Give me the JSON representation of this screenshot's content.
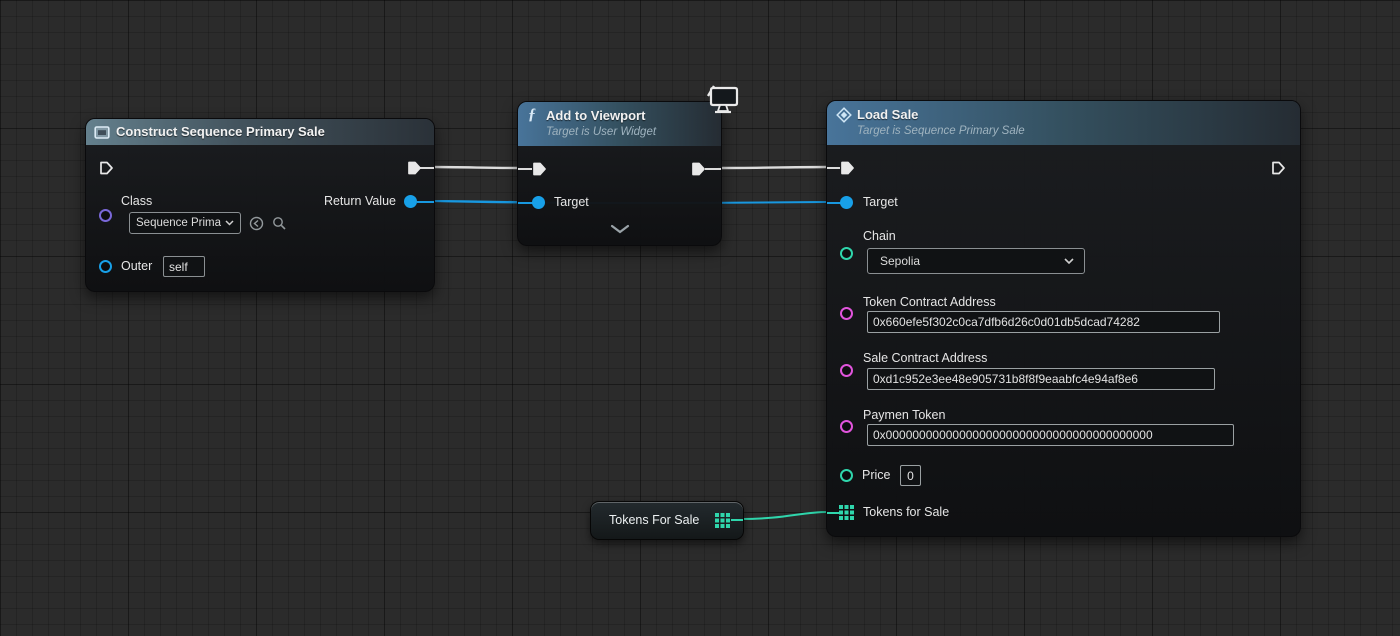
{
  "colors": {
    "canvas_bg": "#2b2b2b",
    "exec": "#e8e8e8",
    "object_pin": "#18a0e8",
    "class_pin": "#7a68d8",
    "string_pin": "#e154dc",
    "enum_pin": "#2fd6ac",
    "array_pin": "#2fd6ac",
    "wire_exec": "#dcdcdc",
    "wire_object": "#1898e0",
    "wire_array": "#2fd6ac"
  },
  "icons": {
    "function_icon": "ƒ",
    "construct_icon": "rounded-square",
    "event_diamond_icon": "diamond",
    "viewport_monitor_icon": "monitor",
    "dropdown_chevron_icon": "▾",
    "use_asset_icon": "circle-left-arrow",
    "browse_asset_icon": "magnifier",
    "collapse_chevron_icon": "⌄",
    "array_grid_icon": "3x3-grid"
  },
  "nodes": {
    "construct": {
      "title": "Construct Sequence Primary Sale",
      "class_label": "Class",
      "class_value": "Sequence Prima",
      "return_value_label": "Return Value",
      "outer_label": "Outer",
      "outer_value": "self"
    },
    "add_to_viewport": {
      "title": "Add to Viewport",
      "subtitle": "Target is User Widget",
      "target_label": "Target"
    },
    "load_sale": {
      "title": "Load Sale",
      "subtitle": "Target is Sequence Primary Sale",
      "target_label": "Target",
      "chain_label": "Chain",
      "chain_value": "Sepolia",
      "token_contract_label": "Token Contract Address",
      "token_contract_value": "0x660efe5f302c0ca7dfb6d26c0d01db5dcad74282",
      "sale_contract_label": "Sale Contract Address",
      "sale_contract_value": "0xd1c952e3ee48e905731b8f8f9eaabfc4e94af8e6",
      "payment_token_label": "Paymen Token",
      "payment_token_value": "0x0000000000000000000000000000000000000000",
      "price_label": "Price",
      "price_value": "0",
      "tokens_for_sale_label": "Tokens for Sale"
    },
    "tokens_variable": {
      "label": "Tokens For Sale"
    }
  },
  "connections": [
    {
      "from": "Construct Sequence Primary Sale.exec_out",
      "to": "Add to Viewport.exec_in",
      "type": "exec"
    },
    {
      "from": "Add to Viewport.exec_out",
      "to": "Load Sale.exec_in",
      "type": "exec"
    },
    {
      "from": "Construct Sequence Primary Sale.Return Value",
      "to": "Add to Viewport.Target",
      "type": "object"
    },
    {
      "from": "Construct Sequence Primary Sale.Return Value",
      "to": "Load Sale.Target",
      "type": "object"
    },
    {
      "from": "Tokens For Sale.output",
      "to": "Load Sale.Tokens for Sale",
      "type": "array"
    }
  ]
}
